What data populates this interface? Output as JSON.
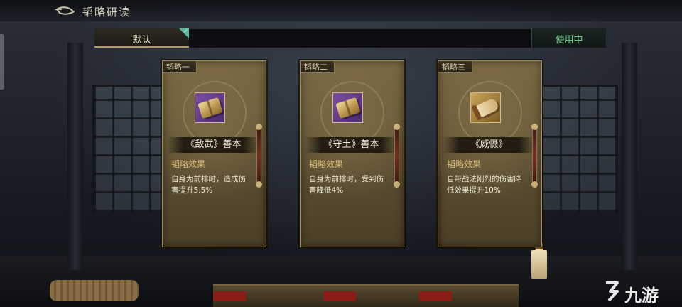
{
  "header": {
    "title": "韬略研读"
  },
  "tabs": {
    "default_label": "默认",
    "in_use_label": "使用中"
  },
  "cards": [
    {
      "tag": "韬略一",
      "name": "《敌武》善本",
      "effect_title": "韬略效果",
      "effect_desc": "自身为前排时，造成伤害提升5.5%",
      "icon": "book-icon",
      "icon_bg": "#6a3f92"
    },
    {
      "tag": "韬略二",
      "name": "《守土》善本",
      "effect_title": "韬略效果",
      "effect_desc": "自身为前排时，受到伤害降低4%",
      "icon": "book-icon",
      "icon_bg": "#6a3f92"
    },
    {
      "tag": "韬略三",
      "name": "《威慑》",
      "effect_title": "韬略效果",
      "effect_desc": "自带战法刚烈的伤害降低效果提升10%",
      "icon": "scroll-icon",
      "icon_bg": "#b28a3e"
    }
  ],
  "watermark": {
    "text": "九游"
  }
}
